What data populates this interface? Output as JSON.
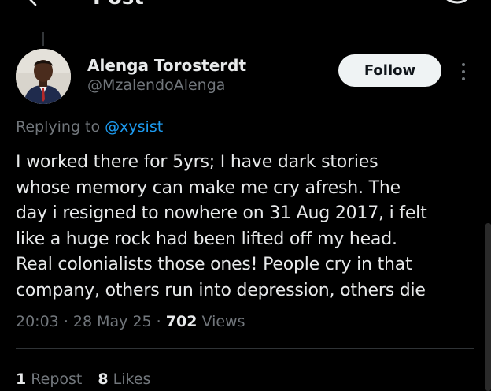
{
  "header": {
    "title": "Post",
    "back_icon": "arrow-left-icon",
    "grok_icon": "grok-icon"
  },
  "post": {
    "author_name": "Alenga Torosterdt",
    "author_handle": "@MzalendoAlenga",
    "follow_label": "Follow",
    "replying_prefix": "Replying to",
    "replying_to": "@xysist",
    "text_lines": [
      "I worked there for 5yrs; I have dark stories",
      "whose memory can make me cry afresh. The",
      "day i resigned to nowhere on 31 Aug 2017, i felt",
      "like a huge rock had been lifted off my head.",
      "Real colonialists those ones! People cry in that",
      "company, others run into depression, others die"
    ],
    "time": "20:03",
    "date": "28 May 25",
    "views_count": "702",
    "views_label": "Views",
    "reposts_count": "1",
    "reposts_label": "Repost",
    "likes_count": "8",
    "likes_label": "Likes"
  },
  "colors": {
    "background": "#000000",
    "text": "#e7e9ea",
    "muted": "#71767b",
    "link": "#1d9bf0",
    "border": "#2f3336"
  }
}
